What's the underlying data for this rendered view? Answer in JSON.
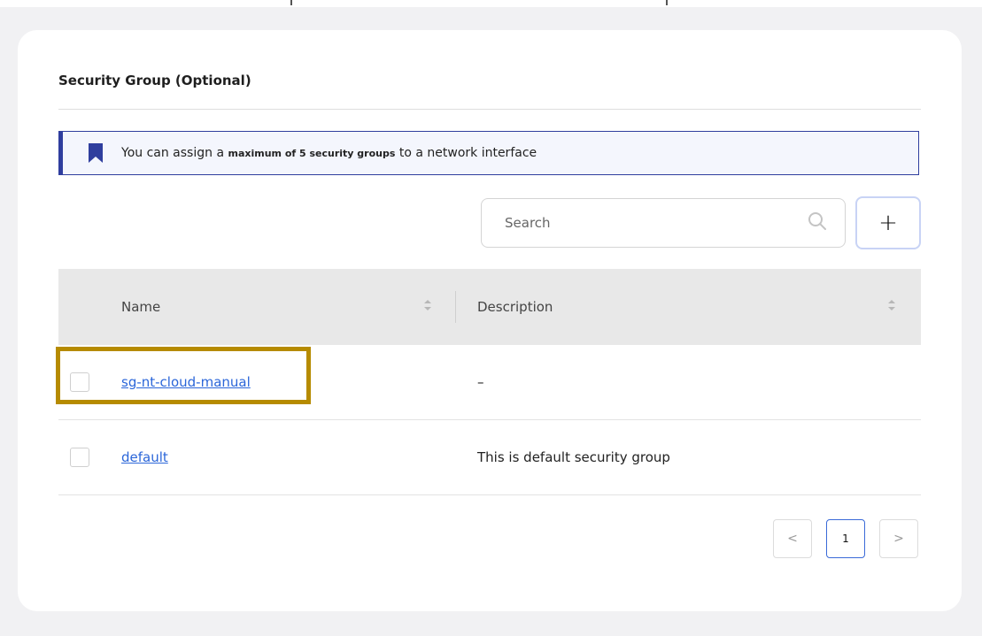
{
  "section": {
    "title": "Security Group (Optional)"
  },
  "banner": {
    "text_prefix": "You can assign a ",
    "text_bold": "maximum of 5 security groups",
    "text_suffix": " to a network interface",
    "icon": "bookmark-icon",
    "accent_color": "#2f3e9e"
  },
  "search": {
    "placeholder": "Search",
    "value": "",
    "icon": "search-icon"
  },
  "toolbar": {
    "add_label": "+"
  },
  "table": {
    "columns": [
      "Name",
      "Description"
    ],
    "rows": [
      {
        "name": "sg-nt-cloud-manual",
        "description": "–",
        "checked": false,
        "highlighted": true
      },
      {
        "name": "default",
        "description": "This is default security group",
        "checked": false,
        "highlighted": false
      }
    ]
  },
  "pagination": {
    "prev_label": "<",
    "current_page": "1",
    "next_label": ">"
  },
  "colors": {
    "link": "#2b66d9",
    "highlight": "#b68b00",
    "header_bg": "#e8e8e8"
  }
}
